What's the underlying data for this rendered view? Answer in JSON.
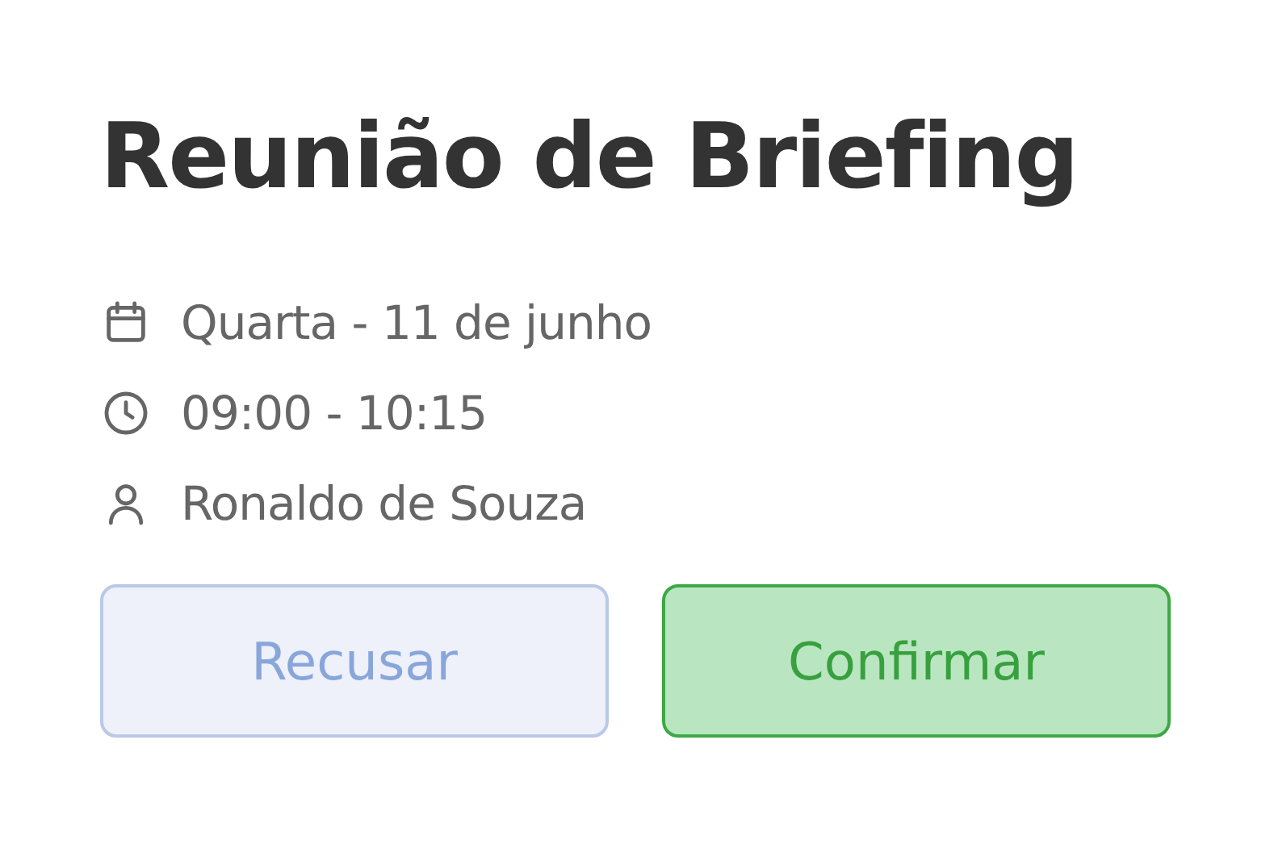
{
  "title": "Reunião de Briefing",
  "details": [
    {
      "kind": "date",
      "text": "Quarta - 11 de junho"
    },
    {
      "kind": "time",
      "text": "09:00 - 10:15"
    },
    {
      "kind": "person",
      "text": "Ronaldo de Souza"
    }
  ],
  "buttons": [
    {
      "kind": "decline",
      "label": "Recusar"
    },
    {
      "kind": "confirm",
      "label": "Confirmar"
    }
  ]
}
